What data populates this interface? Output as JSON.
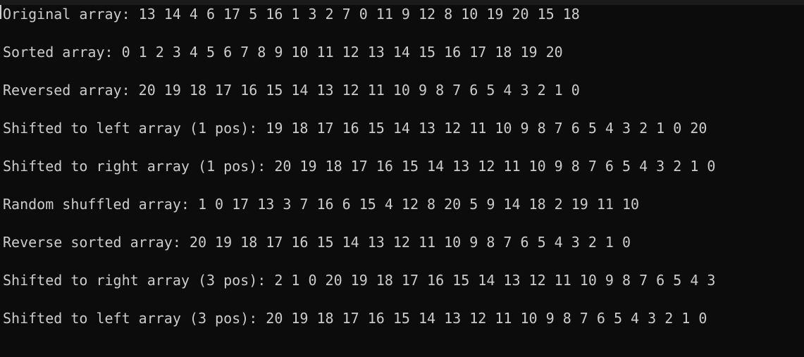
{
  "terminal": {
    "lines": [
      "Original array: 13 14 4 6 17 5 16 1 3 2 7 0 11 9 12 8 10 19 20 15 18",
      "Sorted array: 0 1 2 3 4 5 6 7 8 9 10 11 12 13 14 15 16 17 18 19 20",
      "Reversed array: 20 19 18 17 16 15 14 13 12 11 10 9 8 7 6 5 4 3 2 1 0",
      "Shifted to left array (1 pos): 19 18 17 16 15 14 13 12 11 10 9 8 7 6 5 4 3 2 1 0 20",
      "Shifted to right array (1 pos): 20 19 18 17 16 15 14 13 12 11 10 9 8 7 6 5 4 3 2 1 0",
      "Random shuffled array: 1 0 17 13 3 7 16 6 15 4 12 8 20 5 9 14 18 2 19 11 10",
      "Reverse sorted array: 20 19 18 17 16 15 14 13 12 11 10 9 8 7 6 5 4 3 2 1 0",
      "Shifted to right array (3 pos): 2 1 0 20 19 18 17 16 15 14 13 12 11 10 9 8 7 6 5 4 3",
      "Shifted to left array (3 pos): 20 19 18 17 16 15 14 13 12 11 10 9 8 7 6 5 4 3 2 1 0"
    ],
    "colors": {
      "background": "#0c0c0c",
      "text": "#cccccc"
    }
  }
}
